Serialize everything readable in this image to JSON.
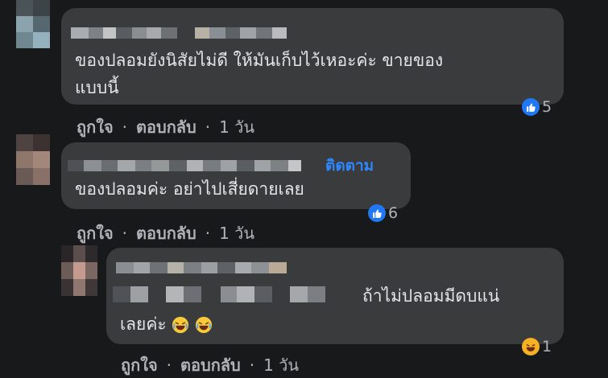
{
  "comments": [
    {
      "text_lines": [
        "ของปลอมยังนิสัยไม่ดี ให้มันเก็บไว้เหอะค่ะ ขายของ",
        "แบบนี้"
      ],
      "reaction_count": "5",
      "reaction_type": "like-icon"
    },
    {
      "follow_label": "ติดตาม",
      "text_lines": [
        "ของปลอมค่ะ อย่าไปเสี่ยดายเลย"
      ],
      "reaction_count": "6",
      "reaction_type": "like-icon"
    },
    {
      "text_lines": [
        "ถ้าไม่ปลอมมีดบแน่",
        "เลยค่ะ"
      ],
      "reaction_count": "1",
      "reaction_type": "haha-icon"
    }
  ],
  "actions": {
    "like_label": "ถูกใจ",
    "reply_label": "ตอบกลับ",
    "separator": "·",
    "time": "1 วัน"
  },
  "colors": {
    "background": "#18191a",
    "bubble": "#3a3b3c",
    "text": "#e4e6eb",
    "secondary_text": "#b0b3b8",
    "link": "#2d88ff",
    "like_blue": "#2078f4",
    "haha_yellow": "#f7b125"
  }
}
